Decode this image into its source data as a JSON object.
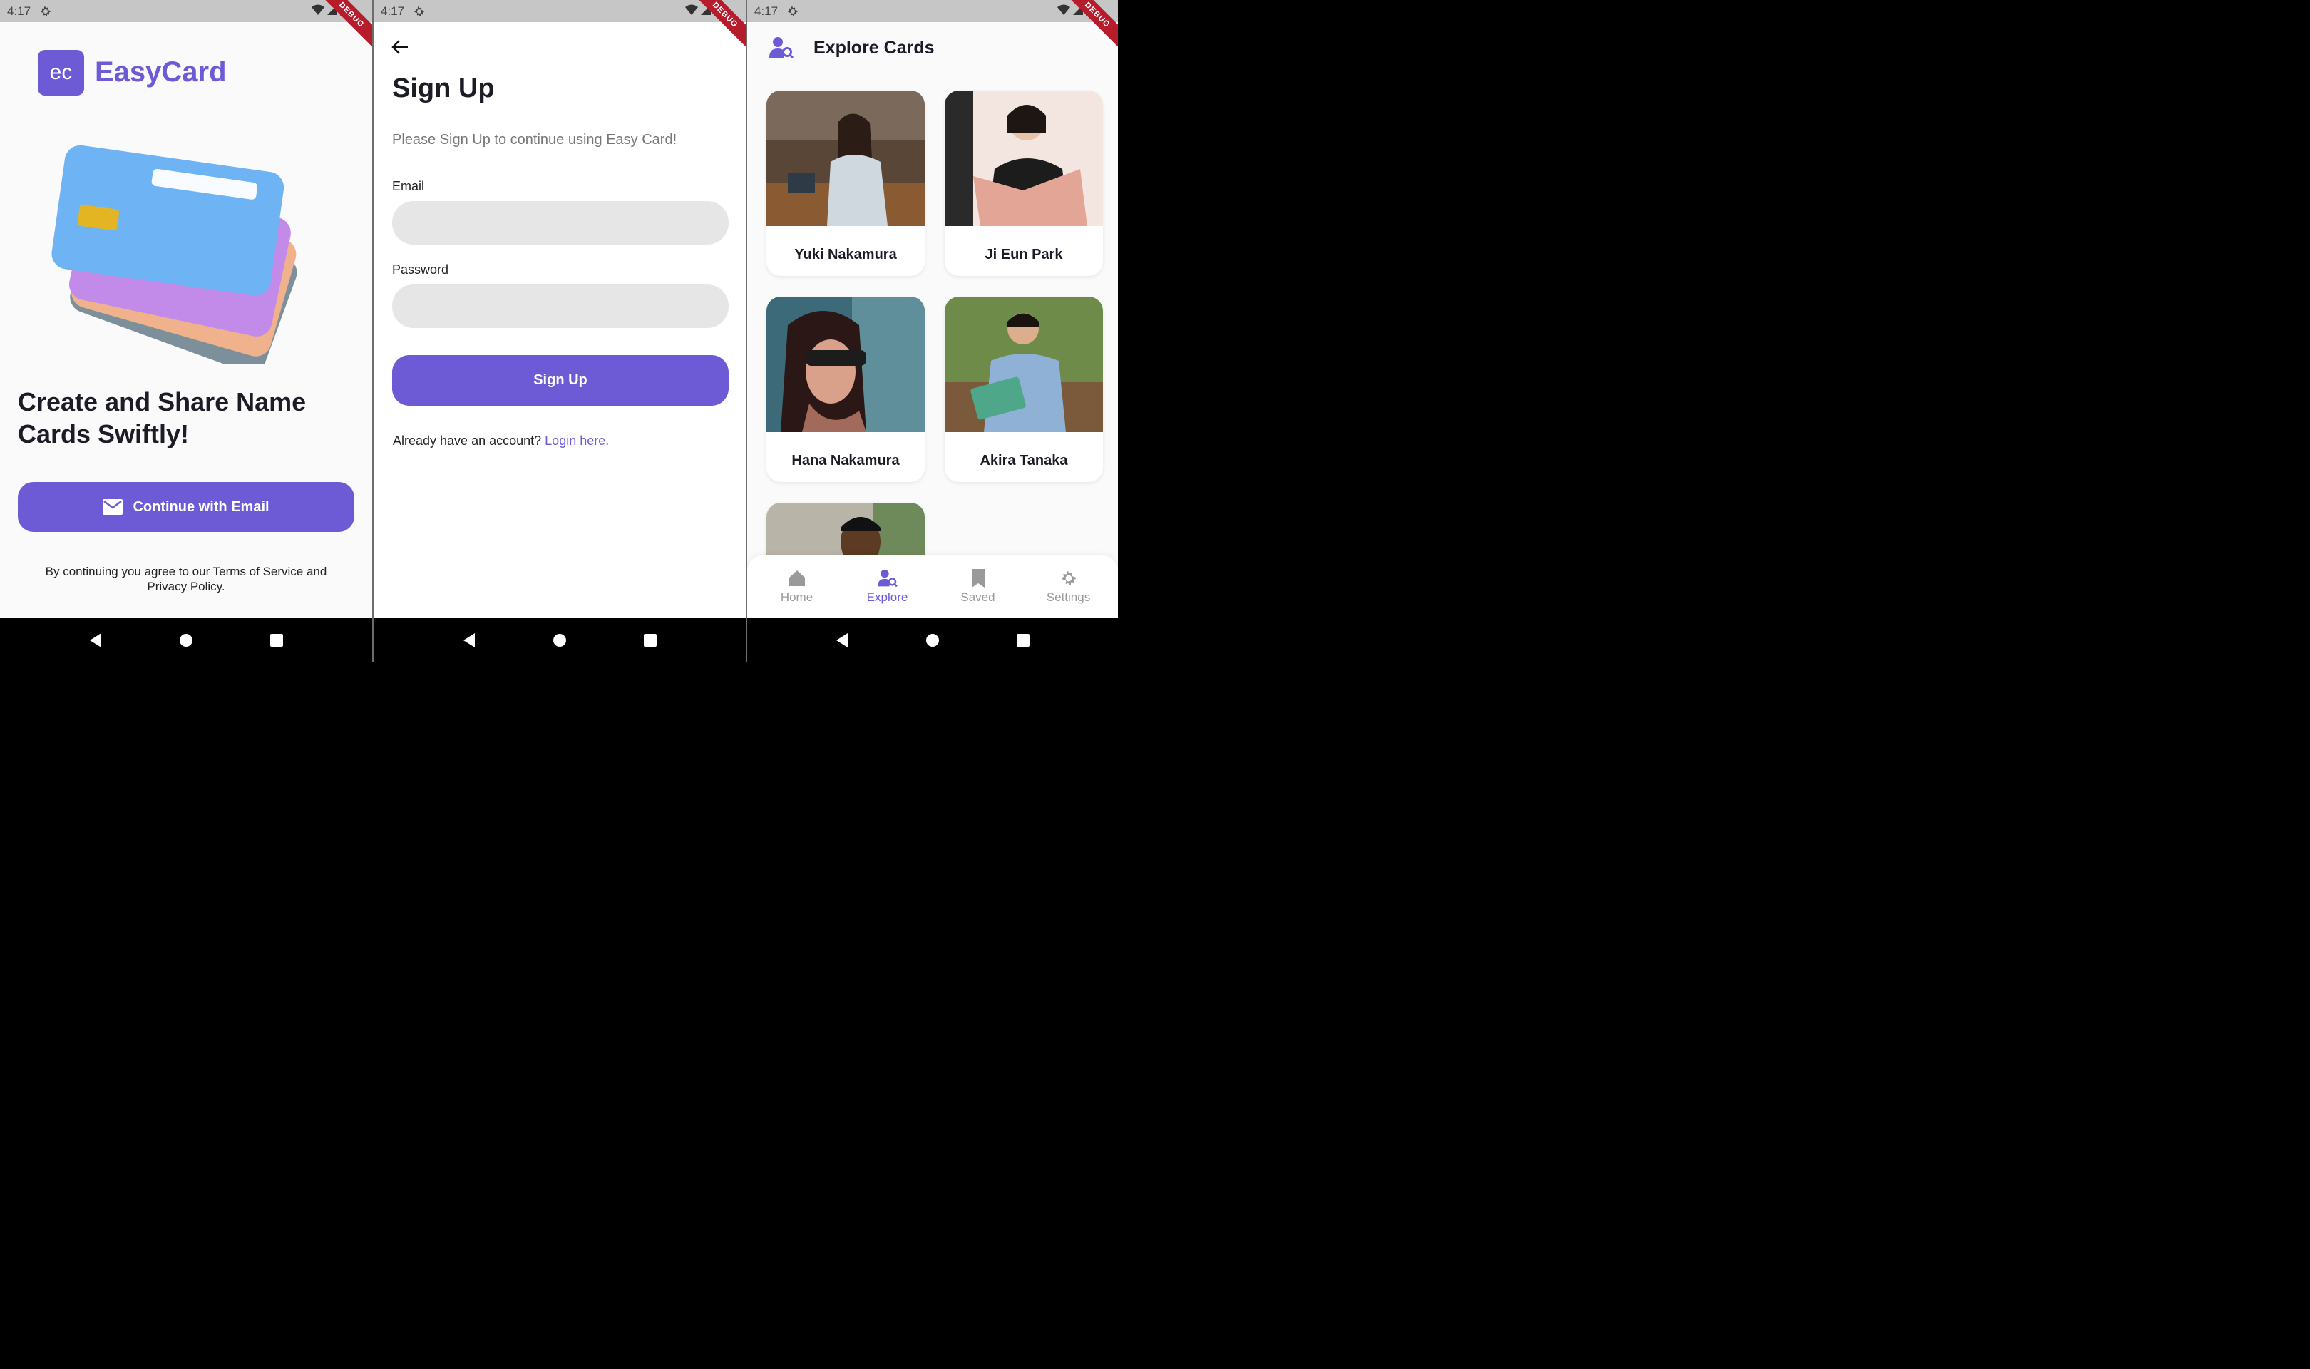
{
  "status_time": "4:17",
  "ribbon": "DEBUG",
  "screen1": {
    "logo_mark": "ec",
    "logo_text": "EasyCard",
    "headline": "Create and Share Name Cards Swiftly!",
    "cta_label": "Continue with Email",
    "cta_icon": "mail-icon",
    "terms": "By continuing you agree to our Terms of Service and Privacy Policy."
  },
  "screen2": {
    "title": "Sign Up",
    "subtitle": "Please Sign Up to continue using Easy Card!",
    "email_label": "Email",
    "email_value": "",
    "password_label": "Password",
    "password_value": "",
    "submit_label": "Sign Up",
    "already_text": "Already have an account?",
    "login_link": "Login here."
  },
  "screen3": {
    "title": "Explore Cards",
    "cards": [
      {
        "name": "Yuki Nakamura"
      },
      {
        "name": "Ji Eun Park"
      },
      {
        "name": "Hana Nakamura"
      },
      {
        "name": "Akira Tanaka"
      }
    ],
    "nav": [
      {
        "label": "Home",
        "icon": "home-icon"
      },
      {
        "label": "Explore",
        "icon": "explore-icon"
      },
      {
        "label": "Saved",
        "icon": "bookmark-icon"
      },
      {
        "label": "Settings",
        "icon": "gear-icon"
      }
    ],
    "active_nav": "Explore"
  },
  "colors": {
    "accent": "#6c5bd4",
    "field_bg": "#e6e6e6",
    "status_bar": "#c6c6c6"
  }
}
